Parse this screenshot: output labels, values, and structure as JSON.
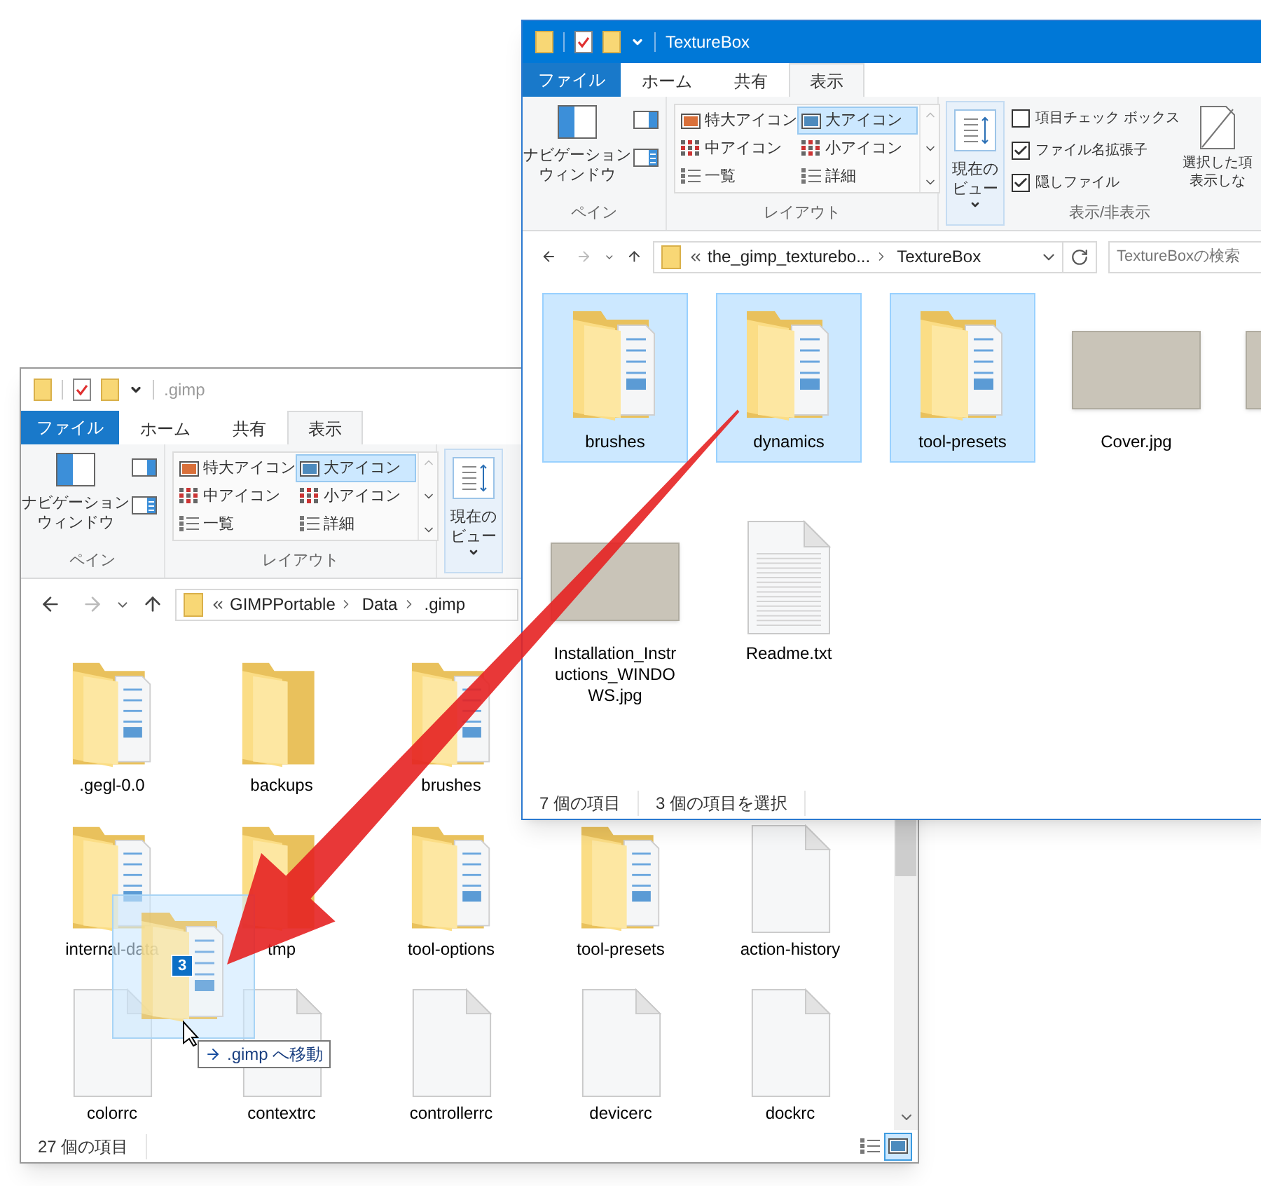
{
  "windows": [
    {
      "title": ".gimp",
      "active": false,
      "tabs": [
        {
          "label": "ファイル",
          "kind": "file",
          "selected": false
        },
        {
          "label": "ホーム",
          "kind": "tab",
          "selected": false
        },
        {
          "label": "共有",
          "kind": "tab",
          "selected": false
        },
        {
          "label": "表示",
          "kind": "tab",
          "selected": true
        }
      ],
      "ribbon": {
        "navigation_pane": [
          "ナビゲーション",
          "ウィンドウ"
        ],
        "pane_group": "ペイン",
        "layouts": [
          {
            "label": "特大アイコン",
            "selected": false
          },
          {
            "label": "大アイコン",
            "selected": true
          },
          {
            "label": "中アイコン",
            "selected": false
          },
          {
            "label": "小アイコン",
            "selected": false
          },
          {
            "label": "一覧",
            "selected": false
          },
          {
            "label": "詳細",
            "selected": false
          }
        ],
        "layout_group": "レイアウト",
        "current_view": [
          "現在の",
          "ビュー"
        ]
      },
      "address": {
        "crumbs": [
          "GIMPPortable",
          "Data",
          ".gimp"
        ]
      },
      "rows": [
        [
          {
            "name": ".gegl-0.0",
            "kind": "folder",
            "selected": false
          },
          {
            "name": "backups",
            "kind": "empty-folder",
            "selected": false
          },
          {
            "name": "brushes",
            "kind": "folder",
            "selected": false
          }
        ],
        [
          {
            "name": "internal-data",
            "kind": "folder",
            "selected": false
          },
          {
            "name": "tmp",
            "kind": "empty-folder",
            "selected": false
          },
          {
            "name": "tool-options",
            "kind": "folder",
            "selected": false
          },
          {
            "name": "tool-presets",
            "kind": "folder",
            "selected": false
          },
          {
            "name": "action-history",
            "kind": "file",
            "selected": false
          }
        ],
        [
          {
            "name": "colorrc",
            "kind": "file",
            "selected": false
          },
          {
            "name": "contextrc",
            "kind": "file",
            "selected": false
          },
          {
            "name": "controllerrc",
            "kind": "file",
            "selected": false
          },
          {
            "name": "devicerc",
            "kind": "file",
            "selected": false
          },
          {
            "name": "dockrc",
            "kind": "file",
            "selected": false
          }
        ]
      ],
      "scrollbar": true,
      "status": [
        "27 個の項目"
      ],
      "view_buttons": [
        {
          "kind": "details",
          "selected": false
        },
        {
          "kind": "large",
          "selected": true
        }
      ]
    },
    {
      "title": "TextureBox",
      "active": true,
      "tabs": [
        {
          "label": "ファイル",
          "kind": "file",
          "selected": false
        },
        {
          "label": "ホーム",
          "kind": "tab",
          "selected": false
        },
        {
          "label": "共有",
          "kind": "tab",
          "selected": false
        },
        {
          "label": "表示",
          "kind": "tab",
          "selected": true
        }
      ],
      "ribbon": {
        "navigation_pane": [
          "ナビゲーション",
          "ウィンドウ"
        ],
        "pane_group": "ペイン",
        "layouts": [
          {
            "label": "特大アイコン",
            "selected": false
          },
          {
            "label": "大アイコン",
            "selected": true
          },
          {
            "label": "中アイコン",
            "selected": false
          },
          {
            "label": "小アイコン",
            "selected": false
          },
          {
            "label": "一覧",
            "selected": false
          },
          {
            "label": "詳細",
            "selected": false
          }
        ],
        "layout_group": "レイアウト",
        "current_view": [
          "現在の",
          "ビュー"
        ],
        "show_hide": {
          "options": [
            {
              "label": "項目チェック ボックス",
              "checked": false
            },
            {
              "label": "ファイル名拡張子",
              "checked": true
            },
            {
              "label": "隠しファイル",
              "checked": true
            }
          ],
          "hide_selected": [
            "選択した項",
            "表示しな"
          ],
          "group": "表示/非表示"
        }
      },
      "address": {
        "crumbs": [
          "the_gimp_texturebo...",
          "TextureBox"
        ]
      },
      "search": {
        "placeholder": "TextureBoxの検索"
      },
      "rows": [
        [
          {
            "name": "brushes",
            "kind": "folder",
            "selected": true
          },
          {
            "name": "dynamics",
            "kind": "folder",
            "selected": true
          },
          {
            "name": "tool-presets",
            "kind": "folder",
            "selected": true
          },
          {
            "name": "Cover.jpg",
            "kind": "image",
            "selected": false
          },
          {
            "kind": "image",
            "selected": false
          }
        ],
        [
          {
            "name": "Installation_Instructions_WINDOWS.jpg",
            "kind": "image",
            "selected": false
          },
          {
            "name": "Readme.txt",
            "kind": "text",
            "selected": false
          }
        ]
      ],
      "scrollbar": false,
      "status": [
        "7 個の項目",
        "3 個の項目を選択"
      ]
    }
  ],
  "drag": {
    "count": "3",
    "tooltip": ".gimp へ移動"
  }
}
